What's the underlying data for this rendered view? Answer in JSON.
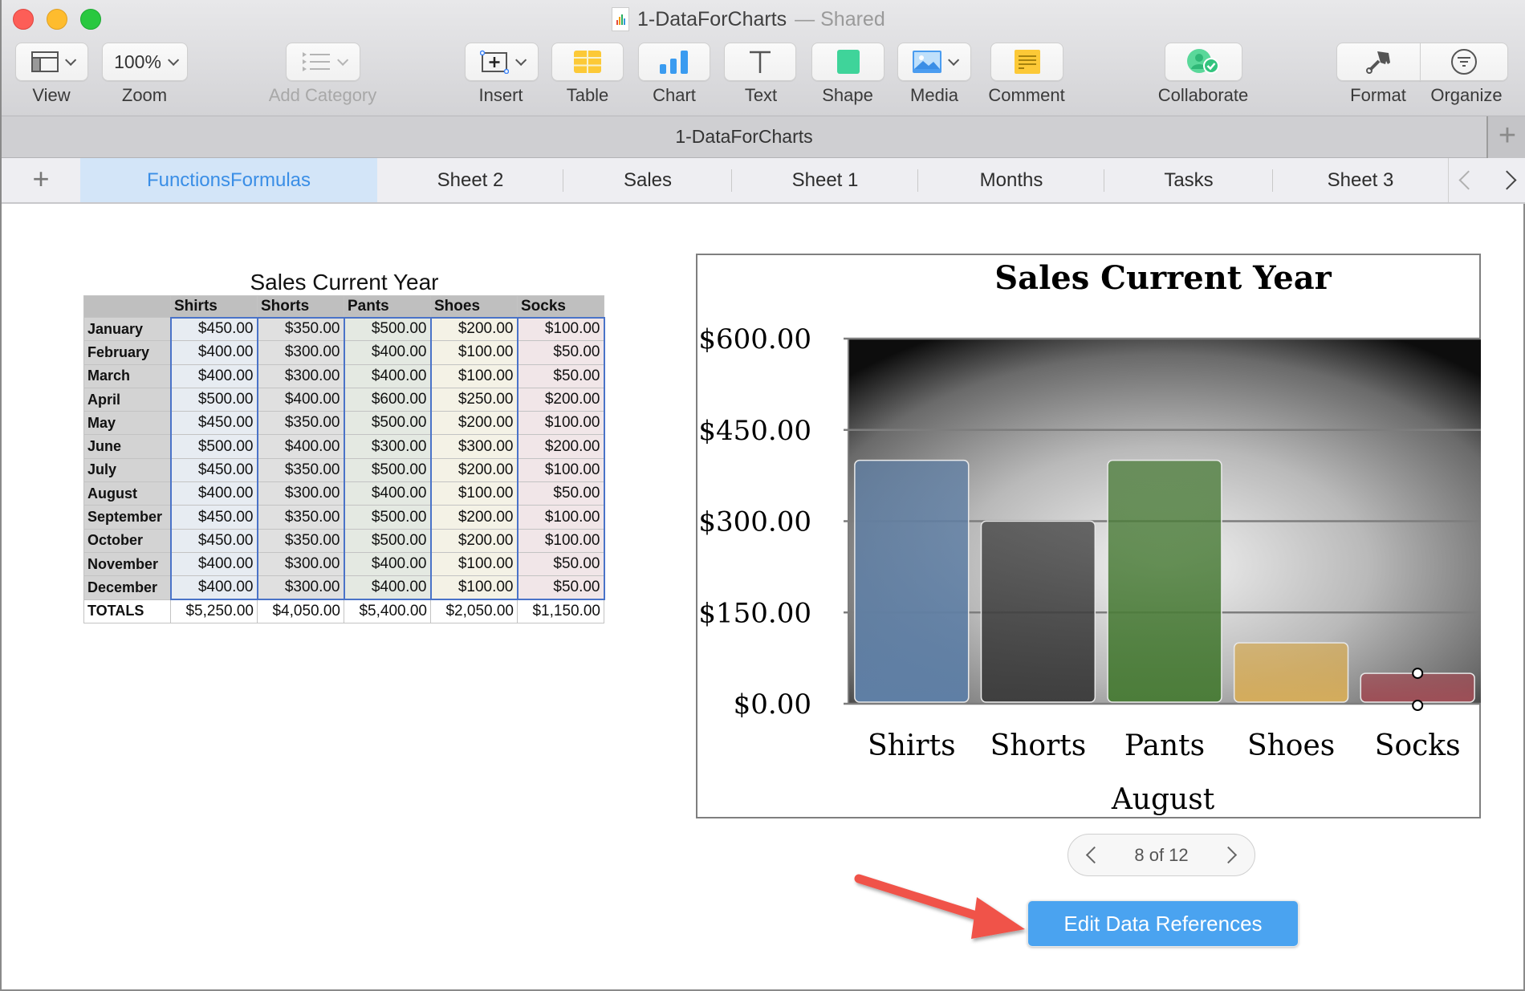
{
  "window": {
    "title": "1-DataForCharts",
    "title_suffix": "— Shared"
  },
  "toolbar": {
    "items": [
      {
        "id": "view",
        "label": "View",
        "icon": "sidebar-layout-icon",
        "enabled": true
      },
      {
        "id": "zoom",
        "label": "Zoom",
        "value": "100%",
        "enabled": true
      },
      {
        "id": "add-category",
        "label": "Add Category",
        "icon": "list-icon",
        "enabled": false
      },
      {
        "id": "insert",
        "label": "Insert",
        "icon": "insert-icon",
        "enabled": true
      },
      {
        "id": "table",
        "label": "Table",
        "icon": "table-icon",
        "enabled": true
      },
      {
        "id": "chart",
        "label": "Chart",
        "icon": "chart-icon",
        "enabled": true
      },
      {
        "id": "text",
        "label": "Text",
        "icon": "text-icon",
        "enabled": true
      },
      {
        "id": "shape",
        "label": "Shape",
        "icon": "shape-icon",
        "enabled": true
      },
      {
        "id": "media",
        "label": "Media",
        "icon": "media-icon",
        "enabled": true
      },
      {
        "id": "comment",
        "label": "Comment",
        "icon": "comment-icon",
        "enabled": true
      },
      {
        "id": "collaborate",
        "label": "Collaborate",
        "icon": "collaborate-icon",
        "enabled": true
      },
      {
        "id": "format",
        "label": "Format",
        "icon": "paintbrush-icon",
        "enabled": true
      },
      {
        "id": "organize",
        "label": "Organize",
        "icon": "filter-icon",
        "enabled": true
      }
    ]
  },
  "docbar": {
    "name": "1-DataForCharts",
    "add_symbol": "+"
  },
  "sheets": {
    "add_symbol": "+",
    "tabs": [
      {
        "label": "FunctionsFormulas",
        "active": true
      },
      {
        "label": "Sheet 2",
        "active": false
      },
      {
        "label": "Sales",
        "active": false
      },
      {
        "label": "Sheet 1",
        "active": false
      },
      {
        "label": "Months",
        "active": false
      },
      {
        "label": "Tasks",
        "active": false
      },
      {
        "label": "Sheet 3",
        "active": false
      }
    ]
  },
  "table": {
    "title": "Sales Current Year",
    "columns": [
      "",
      "Shirts",
      "Shorts",
      "Pants",
      "Shoes",
      "Socks"
    ],
    "rows": [
      [
        "January",
        "$450.00",
        "$350.00",
        "$500.00",
        "$200.00",
        "$100.00"
      ],
      [
        "February",
        "$400.00",
        "$300.00",
        "$400.00",
        "$100.00",
        "$50.00"
      ],
      [
        "March",
        "$400.00",
        "$300.00",
        "$400.00",
        "$100.00",
        "$50.00"
      ],
      [
        "April",
        "$500.00",
        "$400.00",
        "$600.00",
        "$250.00",
        "$200.00"
      ],
      [
        "May",
        "$450.00",
        "$350.00",
        "$500.00",
        "$200.00",
        "$100.00"
      ],
      [
        "June",
        "$500.00",
        "$400.00",
        "$300.00",
        "$300.00",
        "$200.00"
      ],
      [
        "July",
        "$450.00",
        "$350.00",
        "$500.00",
        "$200.00",
        "$100.00"
      ],
      [
        "August",
        "$400.00",
        "$300.00",
        "$400.00",
        "$100.00",
        "$50.00"
      ],
      [
        "September",
        "$450.00",
        "$350.00",
        "$500.00",
        "$200.00",
        "$100.00"
      ],
      [
        "October",
        "$450.00",
        "$350.00",
        "$500.00",
        "$200.00",
        "$100.00"
      ],
      [
        "November",
        "$400.00",
        "$300.00",
        "$400.00",
        "$100.00",
        "$50.00"
      ],
      [
        "December",
        "$400.00",
        "$300.00",
        "$400.00",
        "$100.00",
        "$50.00"
      ]
    ],
    "totals": [
      "TOTALS",
      "$5,250.00",
      "$4,050.00",
      "$5,400.00",
      "$2,050.00",
      "$1,150.00"
    ]
  },
  "chart_data": {
    "type": "bar",
    "title": "Sales Current Year",
    "categories": [
      "Shirts",
      "Shorts",
      "Pants",
      "Shoes",
      "Socks"
    ],
    "values": [
      400,
      300,
      400,
      100,
      50
    ],
    "xlabel": "August",
    "ylabel": "",
    "ylim": [
      0,
      600
    ],
    "yticks": [
      0,
      150,
      300,
      450,
      600
    ],
    "ytick_labels": [
      "$0.00",
      "$150.00",
      "$300.00",
      "$450.00",
      "$600.00"
    ],
    "grid": true,
    "legend": "none",
    "bar_colors": [
      "#5f7fa5",
      "#3f3f3f",
      "#4c7d3a",
      "#d4ac5c",
      "#9e4f57"
    ]
  },
  "pager": {
    "text": "8 of 12",
    "current": 8,
    "total": 12
  },
  "edit_button": {
    "label": "Edit Data References"
  },
  "colors": {
    "accent": "#4aa3f0",
    "active_tab_text": "#3a8ee6",
    "annotation_arrow": "#f0534a"
  }
}
